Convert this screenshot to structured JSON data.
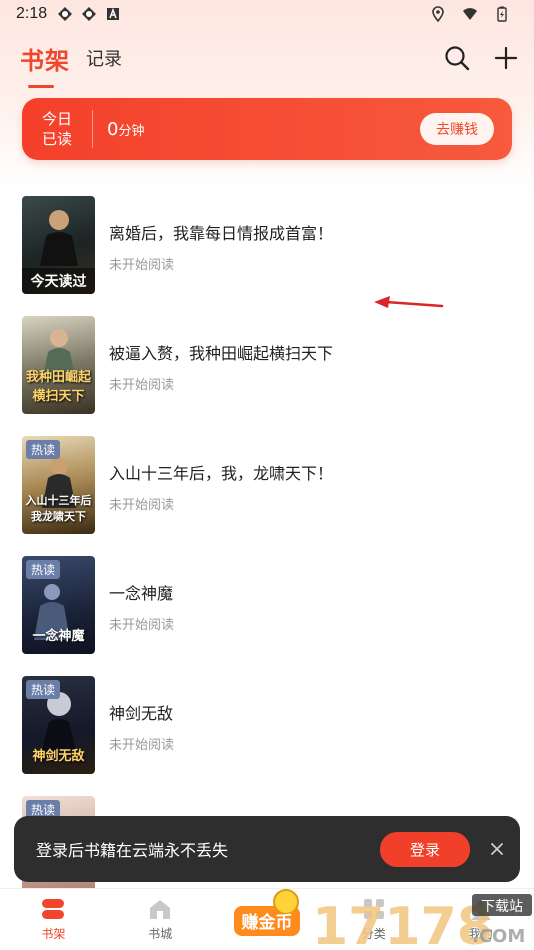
{
  "status_bar": {
    "time": "2:18"
  },
  "header": {
    "tab_bookshelf": "书架",
    "tab_records": "记录"
  },
  "banner": {
    "today_line1": "今日",
    "today_line2": "已读",
    "minutes_value": "0",
    "minutes_unit": "分钟",
    "earn_label": "去赚钱"
  },
  "books": [
    {
      "title": "离婚后，我靠每日情报成首富！",
      "status": "未开始阅读",
      "cover_text": "",
      "cover_badge": "今天读过",
      "hot": ""
    },
    {
      "title": "被逼入赘，我种田崛起横扫天下",
      "status": "未开始阅读",
      "cover_text": "我种田崛起横扫天下",
      "cover_badge": "",
      "hot": ""
    },
    {
      "title": "入山十三年后，我，龙啸天下！",
      "status": "未开始阅读",
      "cover_text": "入山十三年后我龙啸天下",
      "cover_badge": "",
      "hot": "热读"
    },
    {
      "title": "一念神魔",
      "status": "未开始阅读",
      "cover_text": "一念神魔",
      "cover_badge": "",
      "hot": "热读"
    },
    {
      "title": "神剑无敌",
      "status": "未开始阅读",
      "cover_text": "神剑无敌",
      "cover_badge": "",
      "hot": "热读"
    },
    {
      "title": "",
      "status": "",
      "cover_text": "",
      "cover_badge": "",
      "hot": "热读"
    }
  ],
  "toast": {
    "message": "登录后书籍在云端永不丢失",
    "login_label": "登录"
  },
  "tabbar": {
    "bookshelf": "书架",
    "bookstore": "书城",
    "coin": "赚金币",
    "category": "分类",
    "mine": "我的"
  },
  "watermark": {
    "number": "17178",
    "domain": ".COM",
    "label": "下载站"
  },
  "colors": {
    "accent": "#f0472c",
    "banner": "#f4402a",
    "toast_bg": "#2e2e2e"
  }
}
